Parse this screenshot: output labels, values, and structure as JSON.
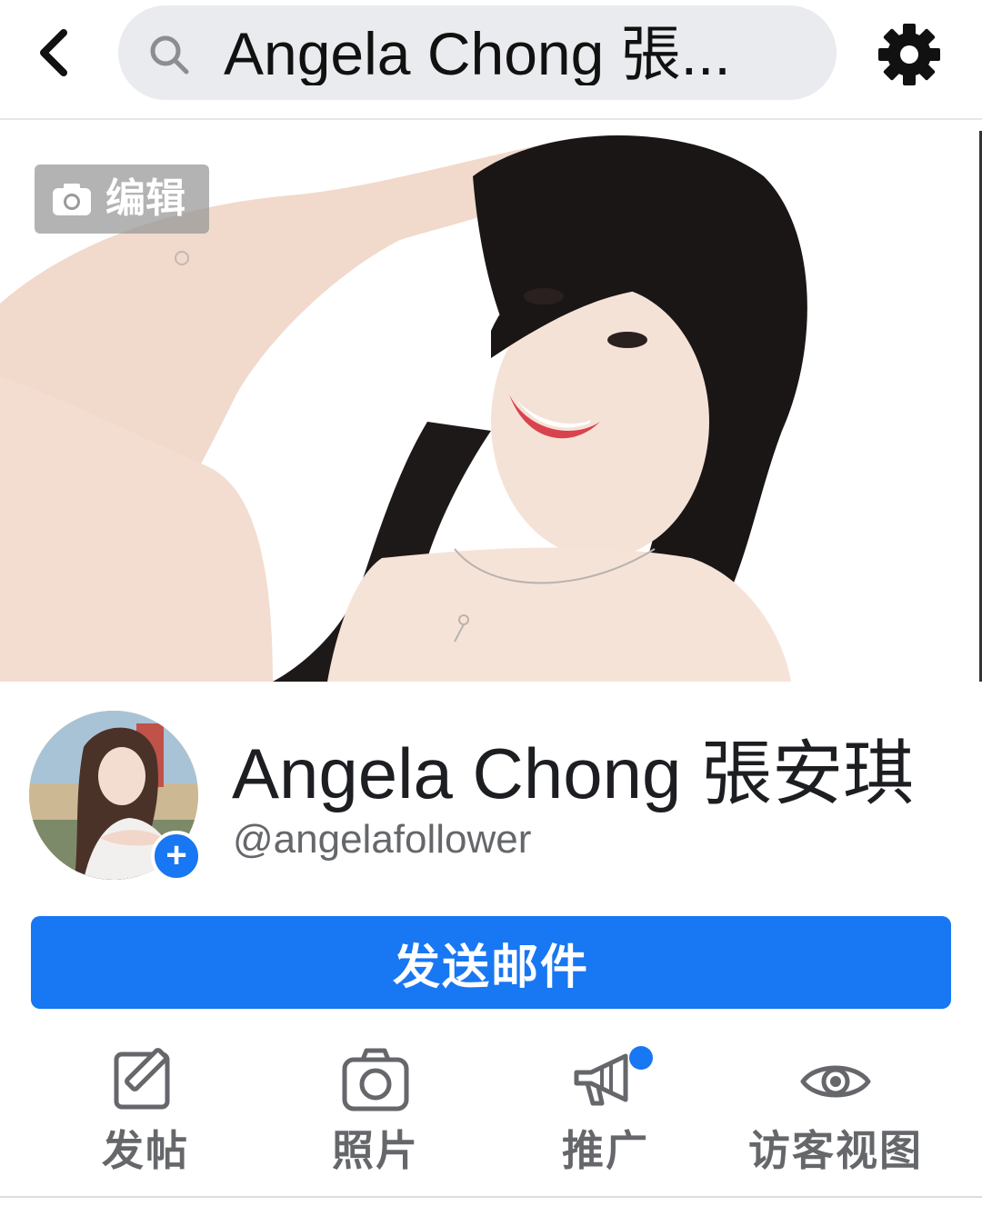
{
  "header": {
    "back_icon": "chevron-left-icon",
    "search_icon": "search-icon",
    "search_value": "Angela Chong 張...",
    "settings_icon": "gear-icon"
  },
  "cover": {
    "edit_label": "编辑",
    "edit_icon": "camera-icon"
  },
  "profile": {
    "name": "Angela Chong 張安琪",
    "handle": "@angelafollower",
    "add_photo_icon": "plus-icon"
  },
  "primary_action": {
    "label": "发送邮件"
  },
  "actions": [
    {
      "label": "发帖",
      "icon": "compose-icon"
    },
    {
      "label": "照片",
      "icon": "camera-icon"
    },
    {
      "label": "推广",
      "icon": "megaphone-icon"
    },
    {
      "label": "访客视图",
      "icon": "eye-icon"
    }
  ],
  "colors": {
    "accent": "#1877f2",
    "search_bg": "#eaebee",
    "secondary_text": "#65676b"
  }
}
